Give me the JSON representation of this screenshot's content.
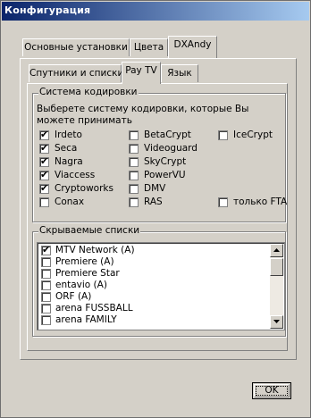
{
  "window": {
    "title": "Конфигурация"
  },
  "tabs_main": [
    {
      "label": "Основные установки",
      "active": false
    },
    {
      "label": "Цвета",
      "active": false
    },
    {
      "label": "DXAndy",
      "active": true
    }
  ],
  "tabs_sub": [
    {
      "label": "Спутники и списки",
      "active": false
    },
    {
      "label": "Pay TV",
      "active": true
    },
    {
      "label": "Язык",
      "active": false
    }
  ],
  "encryption": {
    "group_title": "Система кодировки",
    "description": "Выберете систему кодировки, которые Вы можете принимать",
    "options": [
      {
        "label": "Irdeto",
        "checked": true
      },
      {
        "label": "Seca",
        "checked": true
      },
      {
        "label": "Nagra",
        "checked": true
      },
      {
        "label": "Viaccess",
        "checked": true
      },
      {
        "label": "Cryptoworks",
        "checked": true
      },
      {
        "label": "Conax",
        "checked": false
      },
      {
        "label": "BetaCrypt",
        "checked": false
      },
      {
        "label": "Videoguard",
        "checked": false
      },
      {
        "label": "SkyCrypt",
        "checked": false
      },
      {
        "label": "PowerVU",
        "checked": false
      },
      {
        "label": "DMV",
        "checked": false
      },
      {
        "label": "RAS",
        "checked": false
      },
      {
        "label": "IceCrypt",
        "checked": false
      },
      {
        "label": "только FTA",
        "checked": false
      }
    ]
  },
  "hidden_lists": {
    "group_title": "Скрываемые списки",
    "items": [
      {
        "label": "MTV Network (A)",
        "checked": true
      },
      {
        "label": "Premiere (A)",
        "checked": false
      },
      {
        "label": "Premiere Star",
        "checked": false
      },
      {
        "label": "entavio (A)",
        "checked": false
      },
      {
        "label": "ORF (A)",
        "checked": false
      },
      {
        "label": "arena FUSSBALL",
        "checked": false
      },
      {
        "label": "arena FAMILY",
        "checked": false
      }
    ]
  },
  "buttons": {
    "ok": "OK"
  },
  "colors": {
    "titlebar_start": "#0a246a",
    "titlebar_end": "#a6caf0",
    "face": "#d4d0c8"
  },
  "icons": {
    "check": "checkmark",
    "scroll_up": "arrow-up-icon",
    "scroll_down": "arrow-down-icon"
  }
}
